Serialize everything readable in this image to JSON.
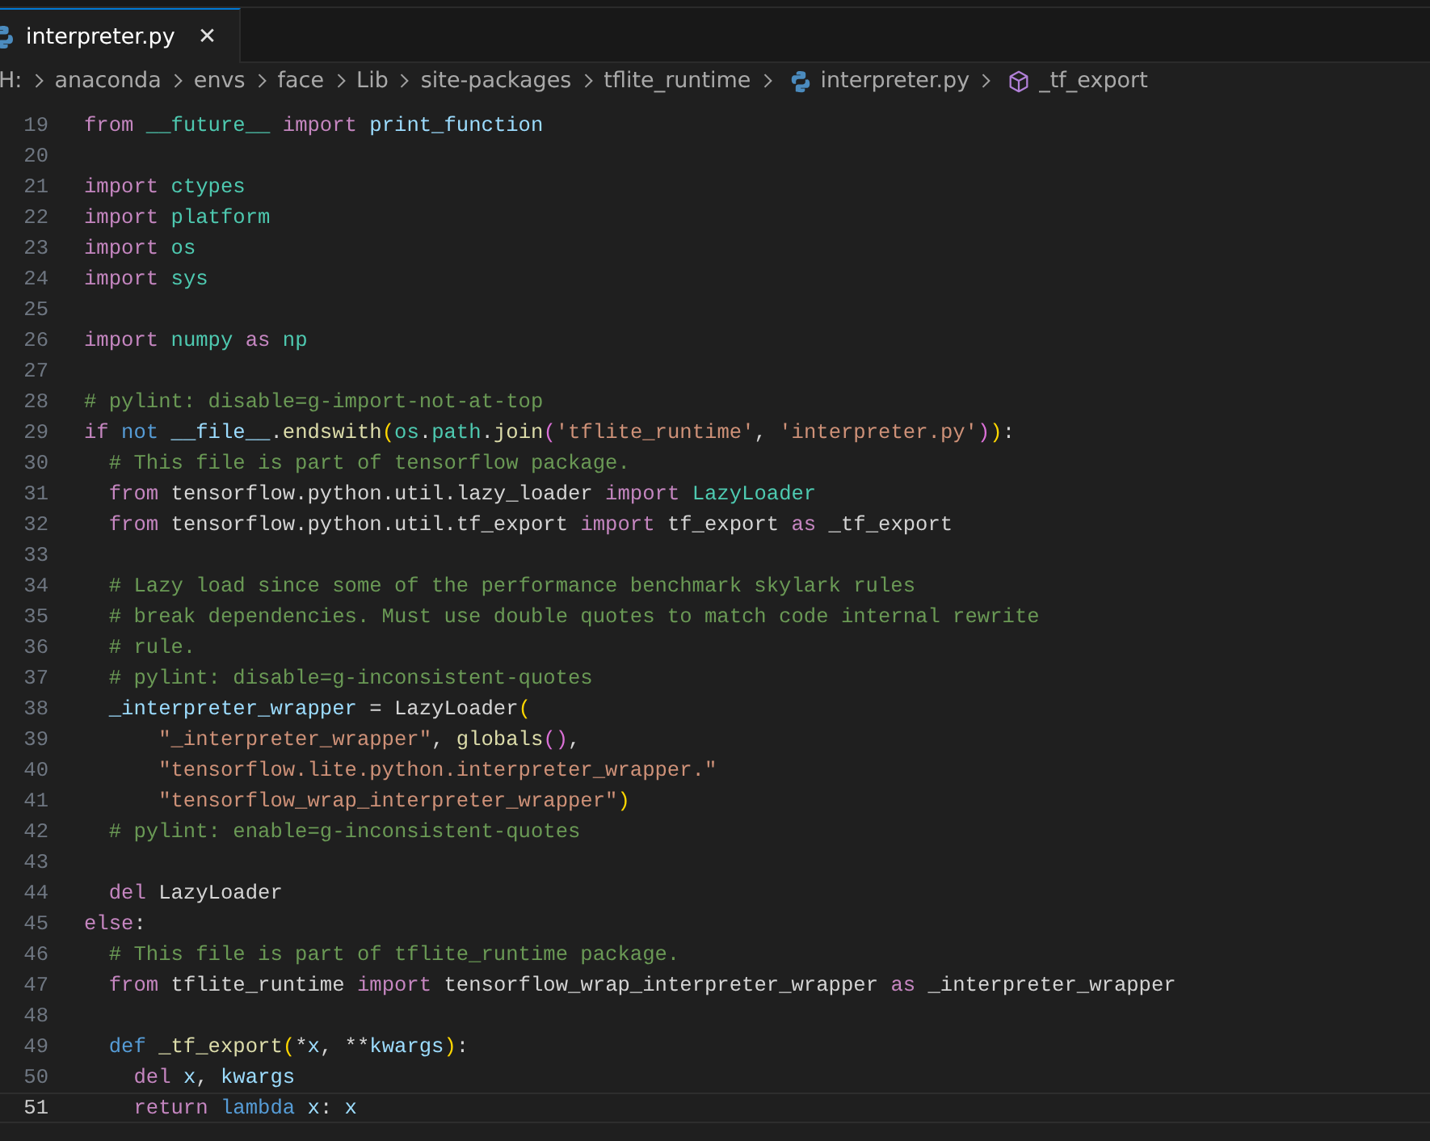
{
  "tabs": [
    {
      "label": "interpreter.py",
      "selected": true,
      "close": "✕"
    }
  ],
  "breadcrumb": [
    {
      "text": "H:",
      "kind": "folder"
    },
    {
      "text": "anaconda",
      "kind": "folder"
    },
    {
      "text": "envs",
      "kind": "folder"
    },
    {
      "text": "face",
      "kind": "folder"
    },
    {
      "text": "Lib",
      "kind": "folder"
    },
    {
      "text": "site-packages",
      "kind": "folder"
    },
    {
      "text": "tflite_runtime",
      "kind": "folder"
    },
    {
      "text": "interpreter.py",
      "kind": "file"
    },
    {
      "text": "_tf_export",
      "kind": "symbol"
    }
  ],
  "lines": [
    {
      "number": "19",
      "current": false,
      "tokens": [
        {
          "text": "from ",
          "kind": "kw"
        },
        {
          "text": "__future__ ",
          "kind": "mod"
        },
        {
          "text": "import ",
          "kind": "kw"
        },
        {
          "text": "print_function",
          "kind": "var"
        }
      ]
    },
    {
      "number": "20",
      "current": false
    },
    {
      "number": "21",
      "current": false,
      "tokens": [
        {
          "text": "import ",
          "kind": "kw"
        },
        {
          "text": "ctypes",
          "kind": "mod"
        }
      ]
    },
    {
      "number": "22",
      "current": false,
      "tokens": [
        {
          "text": "import ",
          "kind": "kw"
        },
        {
          "text": "platform",
          "kind": "mod"
        }
      ]
    },
    {
      "number": "23",
      "current": false,
      "tokens": [
        {
          "text": "import ",
          "kind": "kw"
        },
        {
          "text": "os",
          "kind": "mod"
        }
      ]
    },
    {
      "number": "24",
      "current": false,
      "tokens": [
        {
          "text": "import ",
          "kind": "kw"
        },
        {
          "text": "sys",
          "kind": "mod"
        }
      ]
    },
    {
      "number": "25",
      "current": false
    },
    {
      "number": "26",
      "current": false,
      "tokens": [
        {
          "text": "import ",
          "kind": "kw"
        },
        {
          "text": "numpy ",
          "kind": "mod"
        },
        {
          "text": "as ",
          "kind": "kw"
        },
        {
          "text": "np",
          "kind": "mod"
        }
      ]
    },
    {
      "number": "27",
      "current": false
    },
    {
      "number": "28",
      "current": false,
      "tokens": [
        {
          "text": "# pylint: disable=g-import-not-at-top",
          "kind": "cm"
        }
      ]
    },
    {
      "number": "29",
      "current": false,
      "tokens": [
        {
          "text": "if ",
          "kind": "kw"
        },
        {
          "text": "not ",
          "kind": "kw2"
        },
        {
          "text": "__file__",
          "kind": "var"
        },
        {
          "text": ".",
          "kind": "plain"
        },
        {
          "text": "endswith",
          "kind": "fn"
        },
        {
          "text": "(",
          "kind": "br1"
        },
        {
          "text": "os",
          "kind": "mod"
        },
        {
          "text": ".",
          "kind": "plain"
        },
        {
          "text": "path",
          "kind": "mod"
        },
        {
          "text": ".",
          "kind": "plain"
        },
        {
          "text": "join",
          "kind": "fn"
        },
        {
          "text": "(",
          "kind": "br2"
        },
        {
          "text": "'tflite_runtime'",
          "kind": "str"
        },
        {
          "text": ", ",
          "kind": "plain"
        },
        {
          "text": "'interpreter.py'",
          "kind": "str"
        },
        {
          "text": ")",
          "kind": "br2"
        },
        {
          "text": ")",
          "kind": "br1"
        },
        {
          "text": ":",
          "kind": "plain"
        }
      ]
    },
    {
      "number": "30",
      "current": false,
      "tokens": [
        {
          "text": "  # This file is part of tensorflow package.",
          "kind": "cm"
        }
      ]
    },
    {
      "number": "31",
      "current": false,
      "tokens": [
        {
          "text": "  from ",
          "kind": "kw"
        },
        {
          "text": "tensorflow.python.util.lazy_loader ",
          "kind": "plain"
        },
        {
          "text": "import ",
          "kind": "kw"
        },
        {
          "text": "LazyLoader",
          "kind": "mod"
        }
      ]
    },
    {
      "number": "32",
      "current": false,
      "tokens": [
        {
          "text": "  from ",
          "kind": "kw"
        },
        {
          "text": "tensorflow.python.util.tf_export ",
          "kind": "plain"
        },
        {
          "text": "import ",
          "kind": "kw"
        },
        {
          "text": "tf_export ",
          "kind": "plain"
        },
        {
          "text": "as ",
          "kind": "kw"
        },
        {
          "text": "_tf_export",
          "kind": "plain"
        }
      ]
    },
    {
      "number": "33",
      "current": false
    },
    {
      "number": "34",
      "current": false,
      "tokens": [
        {
          "text": "  # Lazy load since some of the performance benchmark skylark rules",
          "kind": "cm"
        }
      ]
    },
    {
      "number": "35",
      "current": false,
      "tokens": [
        {
          "text": "  # break dependencies. Must use double quotes to match code internal rewrite",
          "kind": "cm"
        }
      ]
    },
    {
      "number": "36",
      "current": false,
      "tokens": [
        {
          "text": "  # rule.",
          "kind": "cm"
        }
      ]
    },
    {
      "number": "37",
      "current": false,
      "tokens": [
        {
          "text": "  # pylint: disable=g-inconsistent-quotes",
          "kind": "cm"
        }
      ]
    },
    {
      "number": "38",
      "current": false,
      "tokens": [
        {
          "text": "  _interpreter_wrapper",
          "kind": "var"
        },
        {
          "text": " = LazyLoader",
          "kind": "plain"
        },
        {
          "text": "(",
          "kind": "br1"
        }
      ]
    },
    {
      "number": "39",
      "current": false,
      "tokens": [
        {
          "text": "      \"_interpreter_wrapper\"",
          "kind": "str"
        },
        {
          "text": ", ",
          "kind": "plain"
        },
        {
          "text": "globals",
          "kind": "fn"
        },
        {
          "text": "()",
          "kind": "br2"
        },
        {
          "text": ",",
          "kind": "plain"
        }
      ]
    },
    {
      "number": "40",
      "current": false,
      "tokens": [
        {
          "text": "      \"tensorflow.lite.python.interpreter_wrapper.\"",
          "kind": "str"
        }
      ]
    },
    {
      "number": "41",
      "current": false,
      "tokens": [
        {
          "text": "      \"tensorflow_wrap_interpreter_wrapper\"",
          "kind": "str"
        },
        {
          "text": ")",
          "kind": "br1"
        }
      ]
    },
    {
      "number": "42",
      "current": false,
      "tokens": [
        {
          "text": "  # pylint: enable=g-inconsistent-quotes",
          "kind": "cm"
        }
      ]
    },
    {
      "number": "43",
      "current": false
    },
    {
      "number": "44",
      "current": false,
      "tokens": [
        {
          "text": "  del ",
          "kind": "kw"
        },
        {
          "text": "LazyLoader",
          "kind": "plain"
        }
      ]
    },
    {
      "number": "45",
      "current": false,
      "tokens": [
        {
          "text": "else",
          "kind": "kw"
        },
        {
          "text": ":",
          "kind": "plain"
        }
      ]
    },
    {
      "number": "46",
      "current": false,
      "tokens": [
        {
          "text": "  # This file is part of tflite_runtime package.",
          "kind": "cm"
        }
      ]
    },
    {
      "number": "47",
      "current": false,
      "tokens": [
        {
          "text": "  from ",
          "kind": "kw"
        },
        {
          "text": "tflite_runtime ",
          "kind": "plain"
        },
        {
          "text": "import ",
          "kind": "kw"
        },
        {
          "text": "tensorflow_wrap_interpreter_wrapper ",
          "kind": "plain"
        },
        {
          "text": "as ",
          "kind": "kw"
        },
        {
          "text": "_interpreter_wrapper",
          "kind": "plain"
        }
      ]
    },
    {
      "number": "48",
      "current": false
    },
    {
      "number": "49",
      "current": false,
      "tokens": [
        {
          "text": "  def ",
          "kind": "kw2"
        },
        {
          "text": "_tf_export",
          "kind": "fn"
        },
        {
          "text": "(",
          "kind": "br1"
        },
        {
          "text": "*",
          "kind": "plain"
        },
        {
          "text": "x",
          "kind": "var"
        },
        {
          "text": ", **",
          "kind": "plain"
        },
        {
          "text": "kwargs",
          "kind": "var"
        },
        {
          "text": ")",
          "kind": "br1"
        },
        {
          "text": ":",
          "kind": "plain"
        }
      ]
    },
    {
      "number": "50",
      "current": false,
      "tokens": [
        {
          "text": "    del ",
          "kind": "kw"
        },
        {
          "text": "x",
          "kind": "var"
        },
        {
          "text": ", ",
          "kind": "plain"
        },
        {
          "text": "kwargs",
          "kind": "var"
        }
      ]
    },
    {
      "number": "51",
      "current": true,
      "tokens": [
        {
          "text": "    return ",
          "kind": "kw"
        },
        {
          "text": "lambda ",
          "kind": "kw2"
        },
        {
          "text": "x",
          "kind": "var"
        },
        {
          "text": ": ",
          "kind": "plain"
        },
        {
          "text": "x",
          "kind": "var"
        }
      ]
    }
  ]
}
